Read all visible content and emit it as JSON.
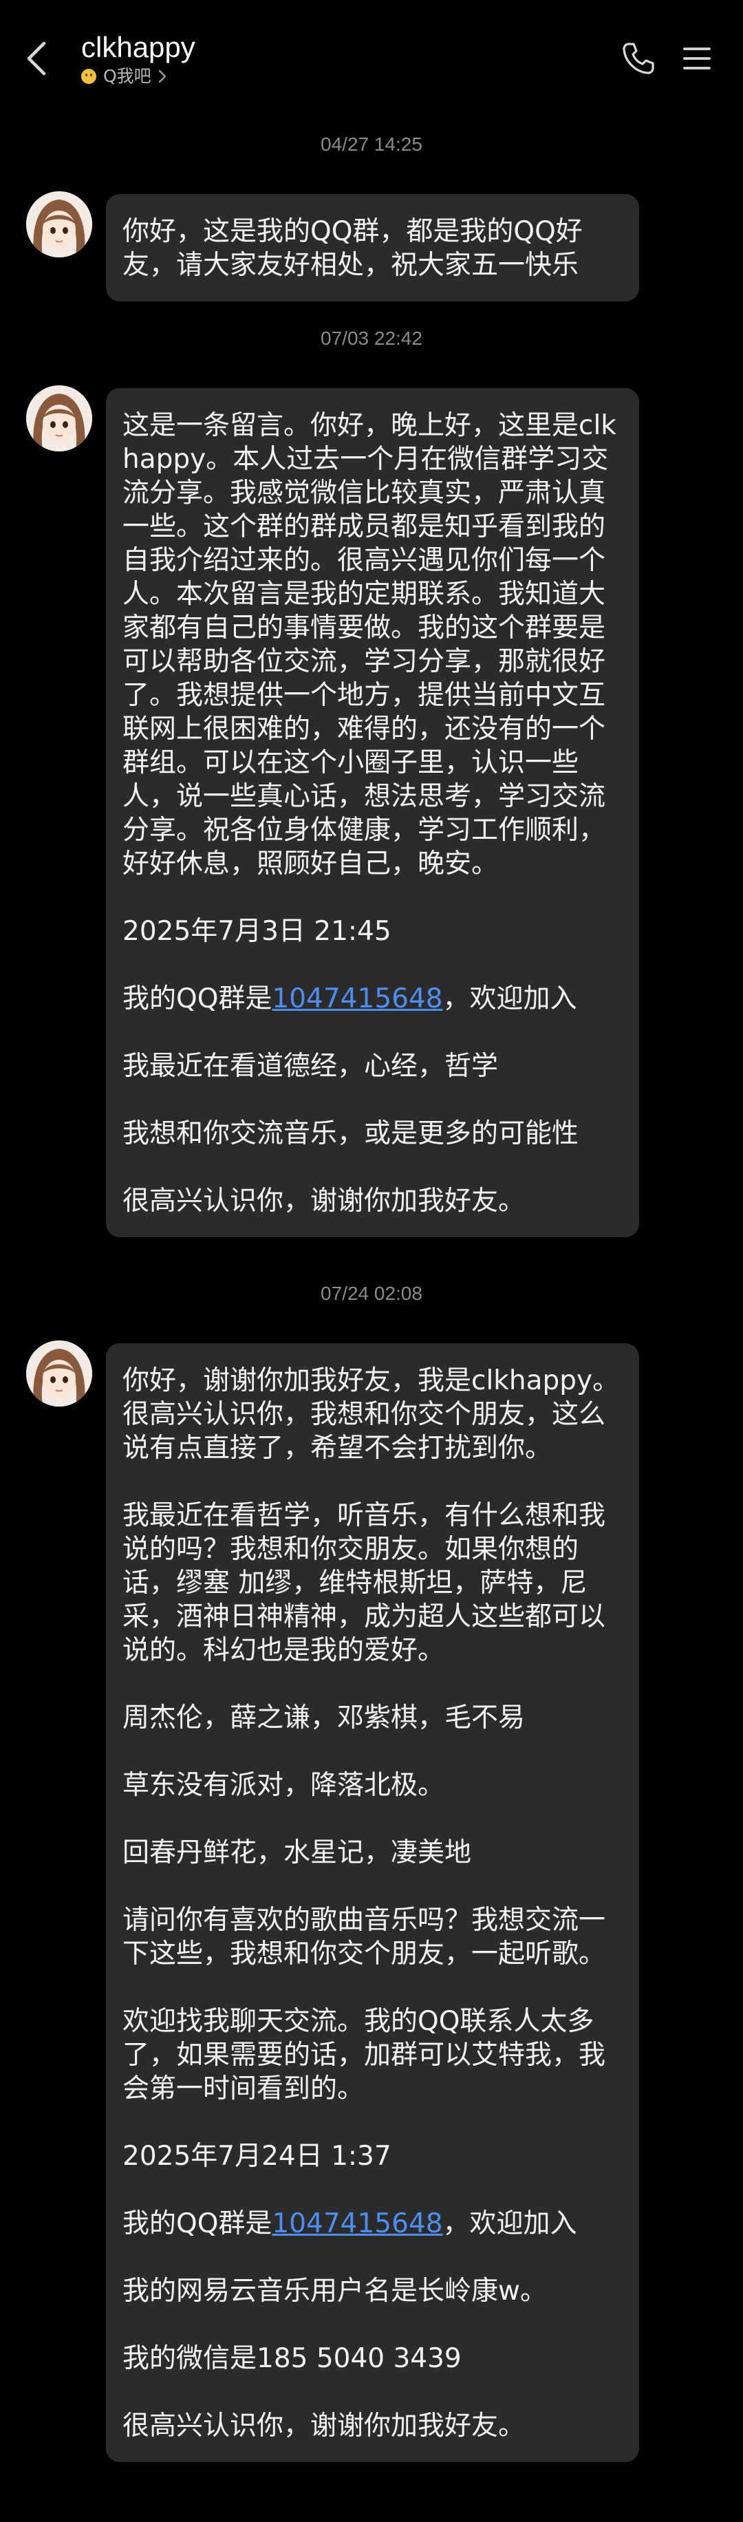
{
  "header": {
    "title": "clkhappy",
    "subtitle": "Q我吧",
    "back_icon": "chevron-left-icon",
    "phone_icon": "phone-icon",
    "menu_icon": "menu-icon"
  },
  "colors": {
    "background": "#000000",
    "bubble": "#2b2b2b",
    "link": "#4d8ff0",
    "timestamp": "#8a8a8a"
  },
  "messages": [
    {
      "timestamp": "04/27 14:25",
      "paragraphs": [
        "你好，这是我的QQ群，都是我的QQ好友，请大家友好相处，祝大家五一快乐"
      ]
    },
    {
      "timestamp": "07/03 22:42",
      "paragraphs": [
        "这是一条留言。你好，晚上好，这里是clkhappy。本人过去一个月在微信群学习交流分享。我感觉微信比较真实，严肃认真一些。这个群的群成员都是知乎看到我的自我介绍过来的。很高兴遇见你们每一个人。本次留言是我的定期联系。我知道大家都有自己的事情要做。我的这个群要是可以帮助各位交流，学习分享，那就很好了。我想提供一个地方，提供当前中文互联网上很困难的，难得的，还没有的一个群组。可以在这个小圈子里，认识一些人，说一些真心话，想法思考，学习交流分享。祝各位身体健康，学习工作顺利，好好休息，照顾好自己，晚安。",
        "2025年7月3日 21:45",
        "我最近在看道德经，心经，哲学",
        "我想和你交流音乐，或是更多的可能性",
        "很高兴认识你，谢谢你加我好友。"
      ],
      "link_line": {
        "prefix": "我的QQ群是",
        "link": "1047415648",
        "suffix": "，欢迎加入"
      }
    },
    {
      "timestamp": "07/24 02:08",
      "paragraphs": [
        "你好，谢谢你加我好友，我是clkhappy。很高兴认识你，我想和你交个朋友，这么说有点直接了，希望不会打扰到你。",
        "我最近在看哲学，听音乐，有什么想和我说的吗？我想和你交朋友。如果你想的话，缪塞 加缪，维特根斯坦，萨特，尼采，酒神日神精神，成为超人这些都可以说的。科幻也是我的爱好。",
        "周杰伦，薛之谦，邓紫棋，毛不易",
        "草东没有派对，降落北极。",
        "回春丹鲜花，水星记，凄美地",
        "请问你有喜欢的歌曲音乐吗？我想交流一下这些，我想和你交个朋友，一起听歌。",
        "欢迎找我聊天交流。我的QQ联系人太多了，如果需要的话，加群可以艾特我，我会第一时间看到的。",
        "2025年7月24日 1:37",
        "我的网易云音乐用户名是长岭康w。",
        "我的微信是185 5040 3439",
        "很高兴认识你，谢谢你加我好友。"
      ],
      "link_line": {
        "prefix": "我的QQ群是",
        "link": "1047415648",
        "suffix": "，欢迎加入"
      }
    }
  ]
}
